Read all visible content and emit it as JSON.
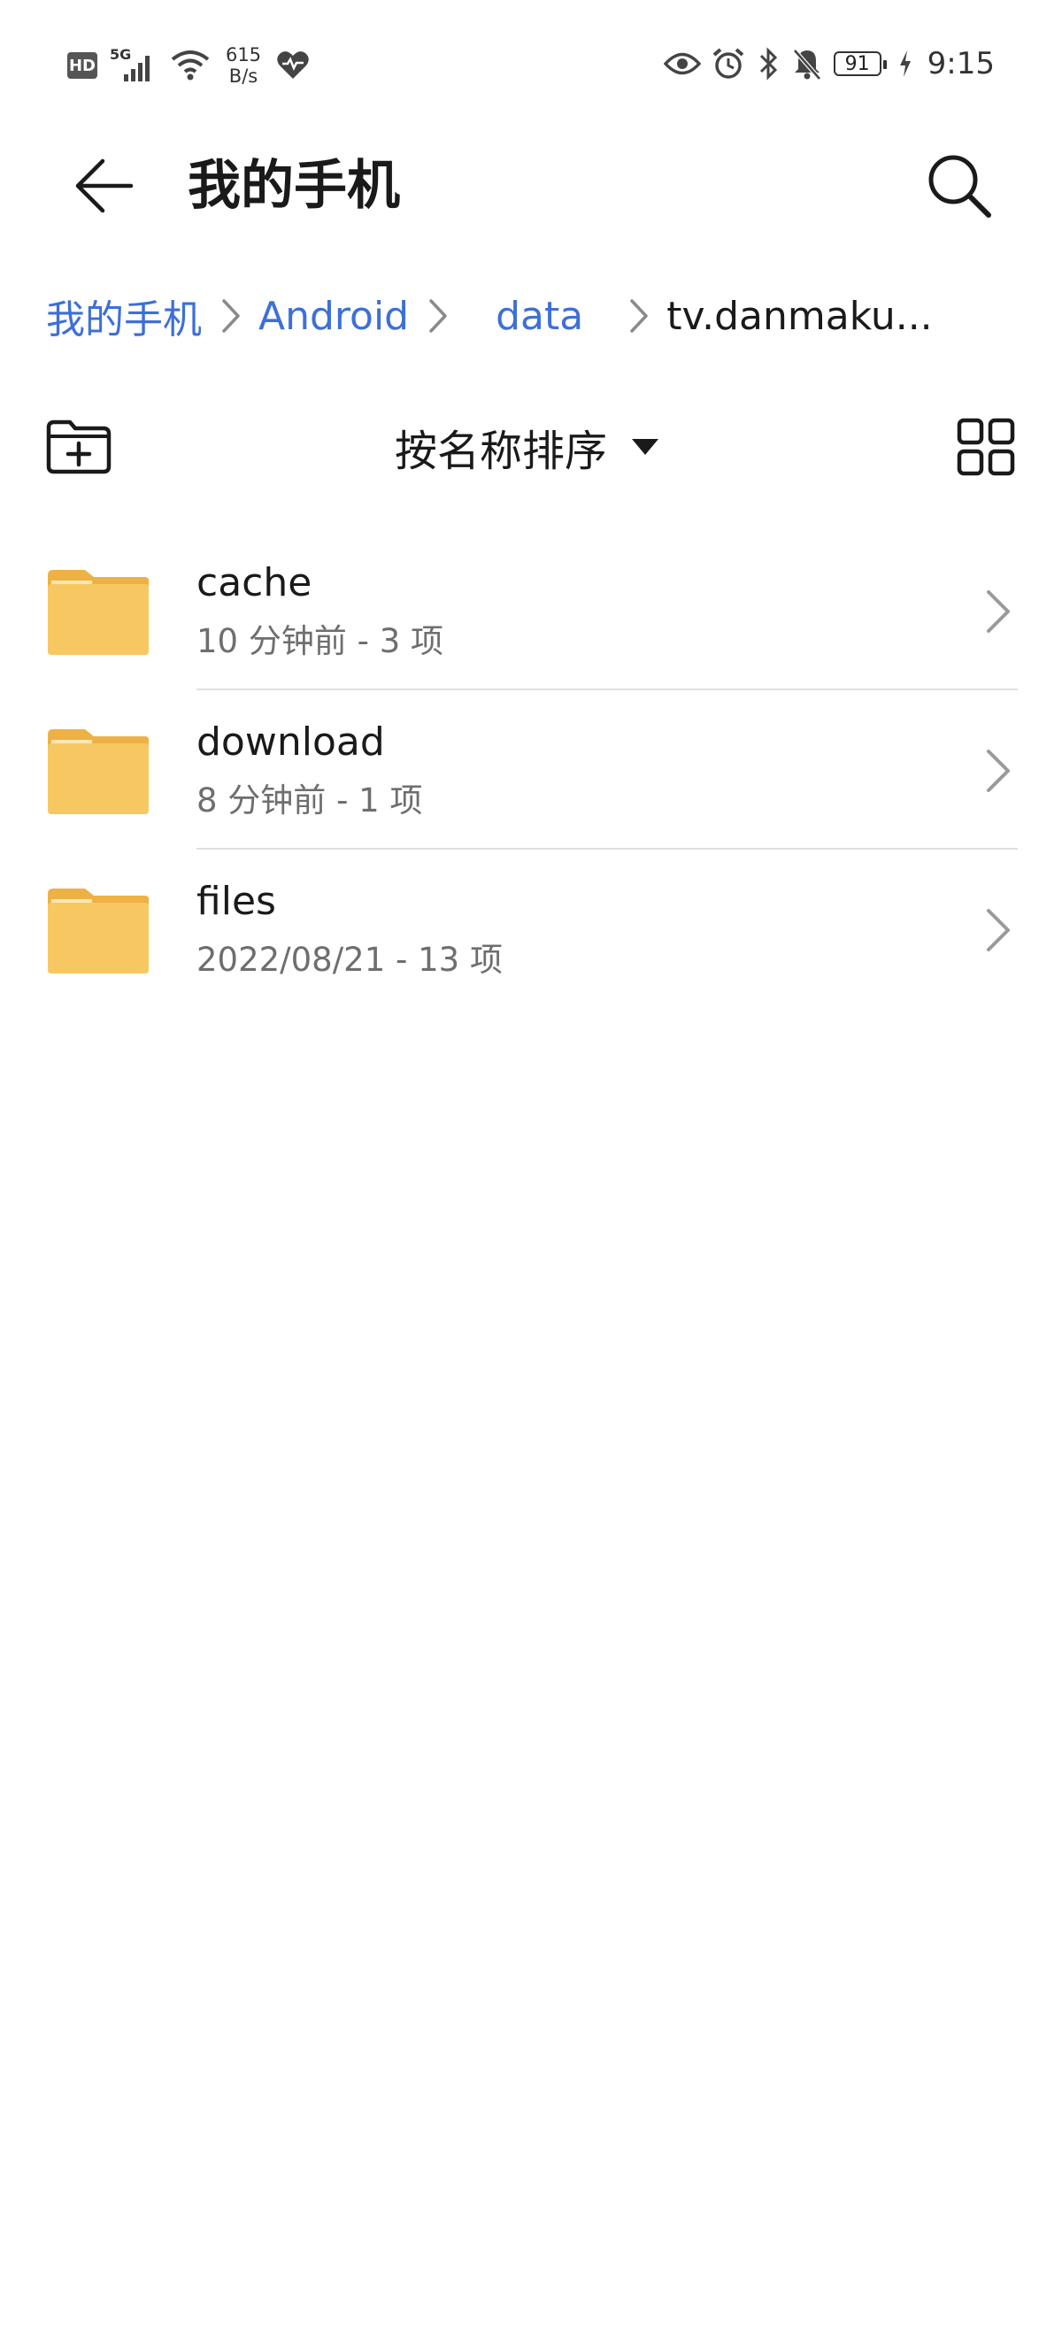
{
  "status_bar": {
    "hd_badge": "HD",
    "network_type": "5G",
    "net_speed_value": "615",
    "net_speed_unit": "B/s",
    "battery_level": "91",
    "time": "9:15",
    "icons": [
      "hd-icon",
      "signal-5g-icon",
      "wifi-icon",
      "heart-rate-icon",
      "eye-icon",
      "alarm-icon",
      "bluetooth-icon",
      "mute-bell-icon",
      "battery-icon",
      "charging-icon"
    ]
  },
  "header": {
    "title": "我的手机"
  },
  "breadcrumb": {
    "items": [
      {
        "label": "我的手机"
      },
      {
        "label": "Android"
      },
      {
        "label": "data"
      },
      {
        "label": "tv.danmaku..."
      }
    ]
  },
  "toolbar": {
    "sort_label": "按名称排序"
  },
  "files": [
    {
      "name": "cache",
      "meta": "10 分钟前 - 3 项"
    },
    {
      "name": "download",
      "meta": "8 分钟前 - 1 项"
    },
    {
      "name": "files",
      "meta": "2022/08/21 - 13 项"
    }
  ],
  "colors": {
    "accent": "#3d6fd8",
    "folder_body": "#f7c862",
    "folder_tab": "#eeb144",
    "text_secondary": "#6e6e6e"
  }
}
